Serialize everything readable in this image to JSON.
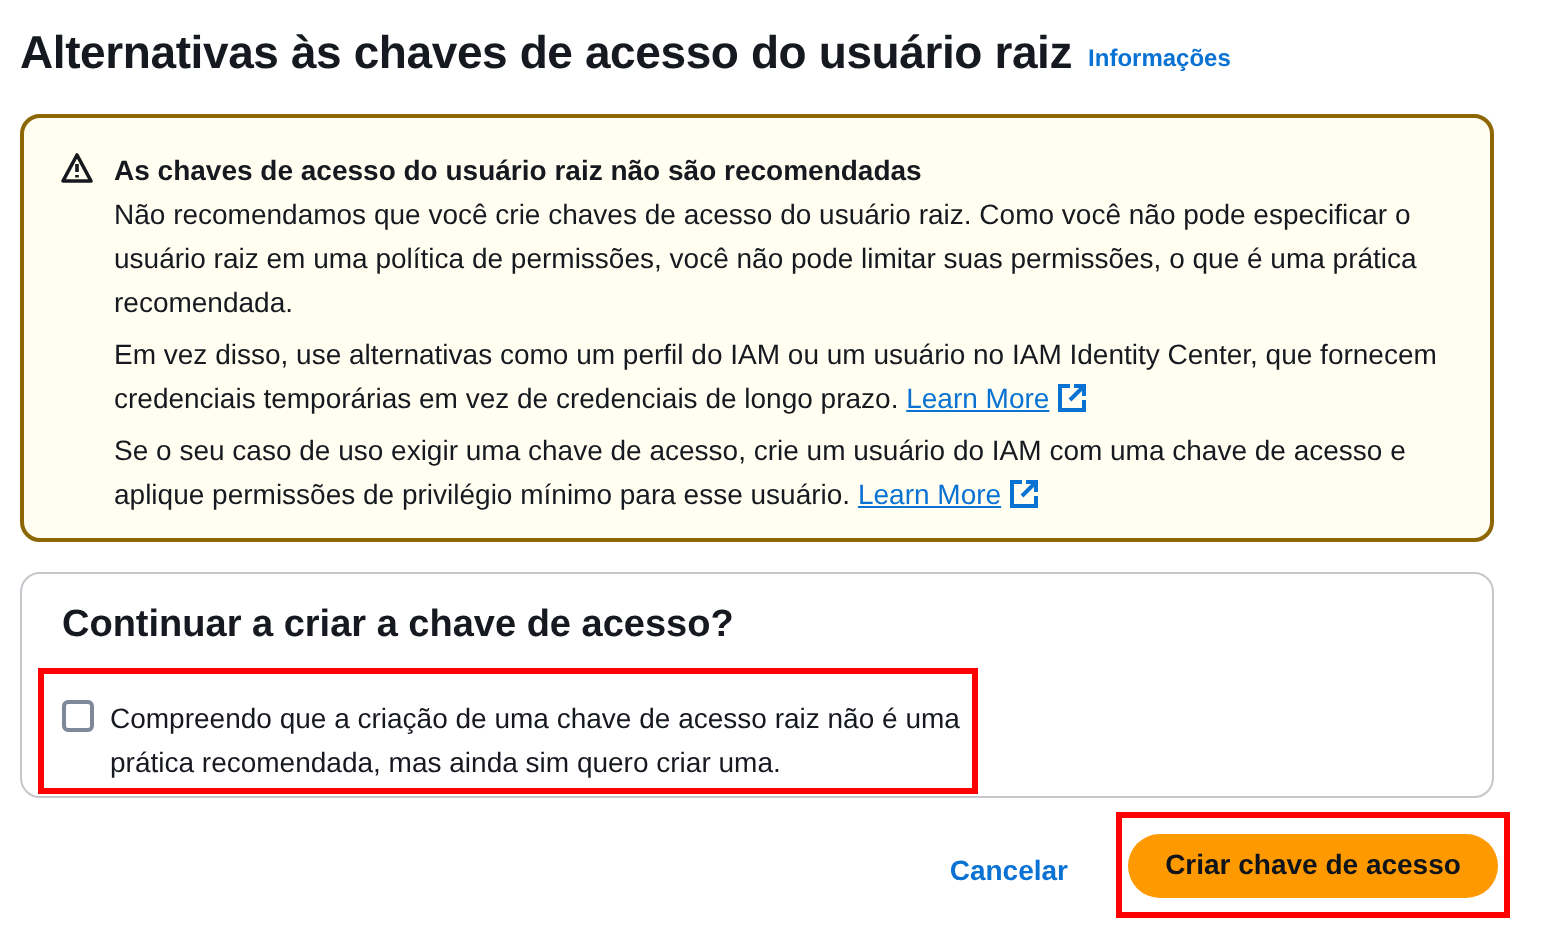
{
  "page": {
    "title": "Alternativas às chaves de acesso do usuário raiz",
    "info_link": "Informações"
  },
  "alert": {
    "title": "As chaves de acesso do usuário raiz não são recomendadas",
    "paragraphs": [
      {
        "text": "Não recomendamos que você crie chaves de acesso do usuário raiz. Como você não pode especificar o usuário raiz em uma política de permissões, você não pode limitar suas permissões, o que é uma prática recomendada."
      },
      {
        "text": "Em vez disso, use alternativas como um perfil do IAM ou um usuário no IAM Identity Center, que fornecem credenciais temporárias em vez de credenciais de longo prazo.",
        "link": "Learn More"
      },
      {
        "text": "Se o seu caso de uso exigir uma chave de acesso, crie um usuário do IAM com uma chave de acesso e aplique permissões de privilégio mínimo para esse usuário.",
        "link": "Learn More"
      }
    ]
  },
  "confirm": {
    "title": "Continuar a criar a chave de acesso?",
    "checkbox": {
      "label": "Compreendo que a criação de uma chave de acesso raiz não é uma prática recomendada, mas ainda sim quero criar uma.",
      "checked": false
    }
  },
  "actions": {
    "cancel": "Cancelar",
    "submit": "Criar chave de acesso"
  }
}
